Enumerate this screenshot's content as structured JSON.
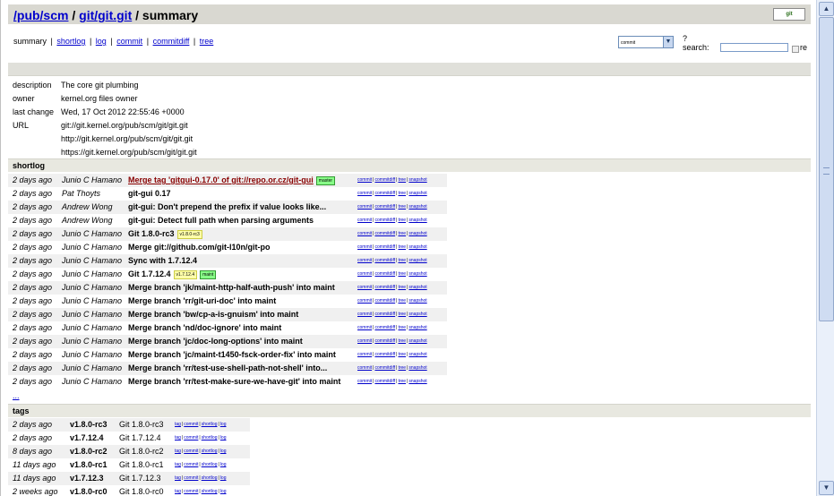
{
  "header": {
    "path1": "/pub/scm",
    "sep1": " / ",
    "path2": "git/git.git",
    "sep2": " / ",
    "page": "summary",
    "logo": "git"
  },
  "nav": {
    "items": [
      "summary",
      "shortlog",
      "log",
      "commit",
      "commitdiff",
      "tree"
    ],
    "separator": "|"
  },
  "search": {
    "select_value": "commit",
    "help": "?",
    "label": "search:",
    "value": "",
    "regex_label": "re"
  },
  "project": {
    "description_label": "description",
    "description": "The core git plumbing",
    "owner_label": "owner",
    "owner": "kernel.org files owner",
    "last_change_label": "last change",
    "last_change": "Wed, 17 Oct 2012 22:55:46 +0000",
    "url_label": "URL",
    "urls": [
      "git://git.kernel.org/pub/scm/git/git.git",
      "http://git.kernel.org/pub/scm/git/git.git",
      "https://git.kernel.org/pub/scm/git/git.git"
    ]
  },
  "shortlog": {
    "title": "shortlog",
    "links": [
      "commit",
      "commitdiff",
      "tree",
      "snapshot"
    ],
    "rows": [
      {
        "age": "2 days ago",
        "author": "Junio C Hamano",
        "subject": "Merge tag 'gitgui-0.17.0' of git://repo.or.cz/git-gui",
        "heads": [
          "master"
        ],
        "tags": []
      },
      {
        "age": "2 days ago",
        "author": "Pat Thoyts",
        "subject": "git-gui 0.17",
        "heads": [],
        "tags": []
      },
      {
        "age": "2 days ago",
        "author": "Andrew Wong",
        "subject": "git-gui: Don't prepend the prefix if value looks like...",
        "heads": [],
        "tags": []
      },
      {
        "age": "2 days ago",
        "author": "Andrew Wong",
        "subject": "git-gui: Detect full path when parsing arguments",
        "heads": [],
        "tags": []
      },
      {
        "age": "2 days ago",
        "author": "Junio C Hamano",
        "subject": "Git 1.8.0-rc3",
        "heads": [],
        "tags": [
          "v1.8.0-rc3"
        ]
      },
      {
        "age": "2 days ago",
        "author": "Junio C Hamano",
        "subject": "Merge git://github.com/git-l10n/git-po",
        "heads": [],
        "tags": []
      },
      {
        "age": "2 days ago",
        "author": "Junio C Hamano",
        "subject": "Sync with 1.7.12.4",
        "heads": [],
        "tags": []
      },
      {
        "age": "2 days ago",
        "author": "Junio C Hamano",
        "subject": "Git 1.7.12.4",
        "heads": [
          "maint"
        ],
        "tags": [
          "v1.7.12.4"
        ]
      },
      {
        "age": "2 days ago",
        "author": "Junio C Hamano",
        "subject": "Merge branch 'jk/maint-http-half-auth-push' into maint",
        "heads": [],
        "tags": []
      },
      {
        "age": "2 days ago",
        "author": "Junio C Hamano",
        "subject": "Merge branch 'rr/git-uri-doc' into maint",
        "heads": [],
        "tags": []
      },
      {
        "age": "2 days ago",
        "author": "Junio C Hamano",
        "subject": "Merge branch 'bw/cp-a-is-gnuism' into maint",
        "heads": [],
        "tags": []
      },
      {
        "age": "2 days ago",
        "author": "Junio C Hamano",
        "subject": "Merge branch 'nd/doc-ignore' into maint",
        "heads": [],
        "tags": []
      },
      {
        "age": "2 days ago",
        "author": "Junio C Hamano",
        "subject": "Merge branch 'jc/doc-long-options' into maint",
        "heads": [],
        "tags": []
      },
      {
        "age": "2 days ago",
        "author": "Junio C Hamano",
        "subject": "Merge branch 'jc/maint-t1450-fsck-order-fix' into maint",
        "heads": [],
        "tags": []
      },
      {
        "age": "2 days ago",
        "author": "Junio C Hamano",
        "subject": "Merge branch 'rr/test-use-shell-path-not-shell' into...",
        "heads": [],
        "tags": []
      },
      {
        "age": "2 days ago",
        "author": "Junio C Hamano",
        "subject": "Merge branch 'rr/test-make-sure-we-have-git' into maint",
        "heads": [],
        "tags": []
      }
    ],
    "more": "..."
  },
  "tags": {
    "title": "tags",
    "links": [
      "tag",
      "commit",
      "shortlog",
      "log"
    ],
    "rows": [
      {
        "age": "2 days ago",
        "name": "v1.8.0-rc3",
        "comment": "Git 1.8.0-rc3"
      },
      {
        "age": "2 days ago",
        "name": "v1.7.12.4",
        "comment": "Git 1.7.12.4"
      },
      {
        "age": "8 days ago",
        "name": "v1.8.0-rc2",
        "comment": "Git 1.8.0-rc2"
      },
      {
        "age": "11 days ago",
        "name": "v1.8.0-rc1",
        "comment": "Git 1.8.0-rc1"
      },
      {
        "age": "11 days ago",
        "name": "v1.7.12.3",
        "comment": "Git 1.7.12.3"
      },
      {
        "age": "2 weeks ago",
        "name": "v1.8.0-rc0",
        "comment": "Git 1.8.0-rc0"
      }
    ]
  },
  "scrollbar": {
    "up_icon": "triangle-up",
    "down_icon": "triangle-down"
  }
}
